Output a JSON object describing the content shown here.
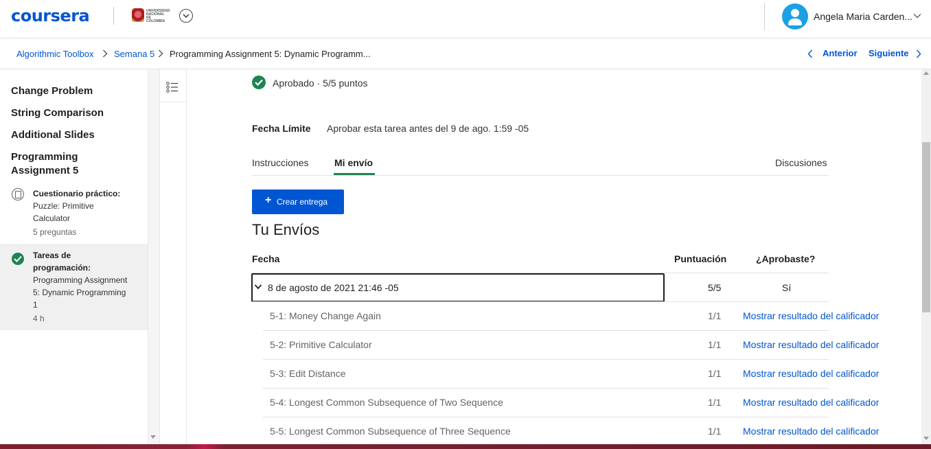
{
  "header": {
    "brand": "coursera",
    "university_lines": [
      "UNIVERSIDAD",
      "NACIONAL",
      "DE COLOMBIA"
    ],
    "user_name": "Angela Maria Carden..."
  },
  "breadcrumb": {
    "items": [
      "Algorithmic Toolbox",
      "Semana 5",
      "Programming Assignment 5: Dynamic Programm..."
    ],
    "prev_label": "Anterior",
    "next_label": "Siguiente"
  },
  "sidebar": {
    "titles": [
      "Change Problem",
      "String Comparison",
      "Additional Slides",
      "Programming Assignment 5"
    ],
    "items": [
      {
        "heading": "Cuestionario práctico:",
        "sub": "Puzzle: Primitive Calculator",
        "meta": "5 preguntas",
        "icon": "quiz-icon"
      },
      {
        "heading": "Tareas de programación:",
        "sub": "Programming Assignment 5: Dynamic Programming 1",
        "meta": "4 h",
        "icon": "check-circle-icon"
      }
    ]
  },
  "main": {
    "status": "Aprobado · 5/5 puntos",
    "deadline_label": "Fecha Límite",
    "deadline_text": "Aprobar esta tarea antes del 9 de ago. 1:59 -05",
    "tabs": [
      "Instrucciones",
      "Mi envío",
      "Discusiones"
    ],
    "active_tab": "Mi envío",
    "create_button": "Crear entrega",
    "section_title": "Tu Envíos",
    "columns": [
      "Fecha",
      "Puntuación",
      "¿Aprobaste?"
    ],
    "submission": {
      "date": "8 de agosto de 2021 21:46 -05",
      "score": "5/5",
      "passed": "Sí"
    },
    "parts": [
      {
        "name": "5-1: Money Change Again",
        "score": "1/1",
        "link": "Mostrar resultado del calificador"
      },
      {
        "name": "5-2: Primitive Calculator",
        "score": "1/1",
        "link": "Mostrar resultado del calificador"
      },
      {
        "name": "5-3: Edit Distance",
        "score": "1/1",
        "link": "Mostrar resultado del calificador"
      },
      {
        "name": "5-4: Longest Common Subsequence of Two Sequence",
        "score": "1/1",
        "link": "Mostrar resultado del calificador"
      },
      {
        "name": "5-5: Longest Common Subsequence of Three Sequence",
        "score": "1/1",
        "link": "Mostrar resultado del calificador"
      }
    ]
  },
  "colors": {
    "brand_blue": "#0056d2",
    "success_green": "#1f8354",
    "avatar_blue": "#1aa0e3"
  }
}
